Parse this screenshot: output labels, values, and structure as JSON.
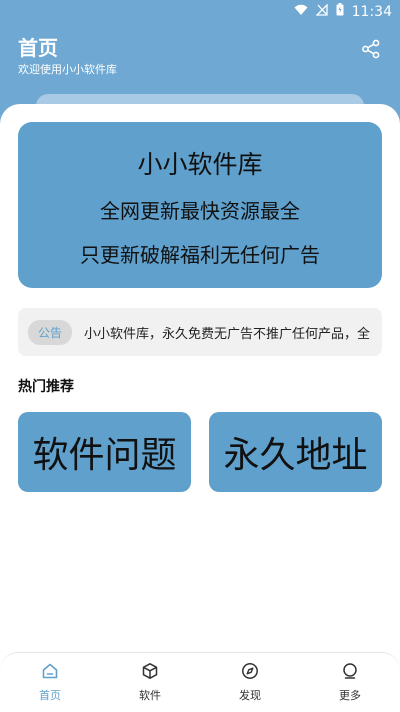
{
  "status_bar": {
    "time": "11:34"
  },
  "header": {
    "title": "首页",
    "subtitle": "欢迎使用小小软件库",
    "share_icon": "share-icon"
  },
  "banner": {
    "title": "小小软件库",
    "line1": "全网更新最快资源最全",
    "line2": "只更新破解福利无任何广告"
  },
  "notice": {
    "badge": "公告",
    "text": "小小软件库，永久免费无广告不推广任何产品，全"
  },
  "recommend": {
    "section_title": "热门推荐",
    "items": [
      {
        "label": "软件问题"
      },
      {
        "label": "永久地址"
      }
    ]
  },
  "bottom_nav": {
    "items": [
      {
        "label": "首页",
        "icon": "home-icon",
        "active": true
      },
      {
        "label": "软件",
        "icon": "cube-icon",
        "active": false
      },
      {
        "label": "发现",
        "icon": "compass-icon",
        "active": false
      },
      {
        "label": "更多",
        "icon": "person-icon",
        "active": false
      }
    ]
  },
  "colors": {
    "primary": "#5fa0cc",
    "header": "#6ea8d3",
    "notice_bg": "#f1f1f1"
  }
}
